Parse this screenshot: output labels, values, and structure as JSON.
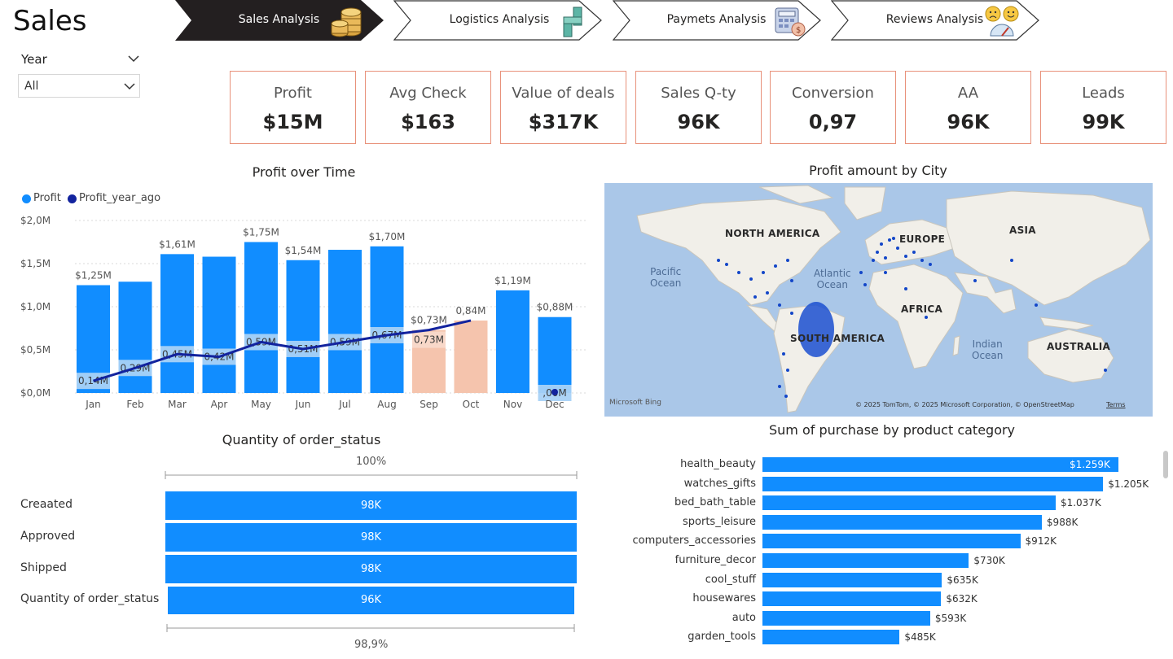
{
  "page_title": "Sales",
  "nav": {
    "tabs": [
      {
        "label": "Sales Analysis",
        "active": true,
        "icon": "coins-icon"
      },
      {
        "label": "Logistics Analysis",
        "active": false,
        "icon": "route-icon"
      },
      {
        "label": "Paymets Analysis",
        "active": false,
        "icon": "calculator-icon"
      },
      {
        "label": "Reviews Analysis",
        "active": false,
        "icon": "emoji-rating-icon"
      }
    ]
  },
  "slicer": {
    "label": "Year",
    "value": "All"
  },
  "kpis": [
    {
      "label": "Profit",
      "value": "$15M"
    },
    {
      "label": "Avg Check",
      "value": "$163"
    },
    {
      "label": "Value of deals",
      "value": "$317K"
    },
    {
      "label": "Sales Q-ty",
      "value": "96K"
    },
    {
      "label": "Conversion",
      "value": "0,97"
    },
    {
      "label": "AA",
      "value": "96K"
    },
    {
      "label": "Leads",
      "value": "99K"
    }
  ],
  "colors": {
    "accent": "#118dff",
    "dark_series": "#12239e",
    "forecast": "#f5c4ad",
    "kpi_border": "#e8917a",
    "active_tab": "#231f20"
  },
  "profit_chart": {
    "title": "Profit over Time",
    "legend": [
      "Profit",
      "Profit_year_ago"
    ],
    "y_ticks": [
      "$2,0M",
      "$1,5M",
      "$1,0M",
      "$0,5M",
      "$0,0M"
    ],
    "chart_data": {
      "type": "bar",
      "categories": [
        "Jan",
        "Feb",
        "Mar",
        "Apr",
        "May",
        "Jun",
        "Jul",
        "Aug",
        "Sep",
        "Oct",
        "Nov",
        "Dec"
      ],
      "series": [
        {
          "name": "Profit",
          "values": [
            1.25,
            1.29,
            1.61,
            1.58,
            1.75,
            1.54,
            1.66,
            1.7,
            0.73,
            0.84,
            1.19,
            0.88
          ]
        },
        {
          "name": "Profit_year_ago",
          "values": [
            0.14,
            0.29,
            0.45,
            0.42,
            0.59,
            0.51,
            0.59,
            0.67,
            0.73,
            0.84,
            null,
            0.0
          ]
        }
      ],
      "highlighted": [
        false,
        false,
        false,
        false,
        false,
        false,
        false,
        false,
        true,
        true,
        false,
        false
      ],
      "ylim": [
        0,
        2.0
      ],
      "top_labels": [
        "$1,25M",
        "",
        "$1,61M",
        "",
        "$1,75M",
        "$1,54M",
        "",
        "$1,70M",
        "$0,73M",
        "0,84M",
        "$1,19M",
        "$0,88M"
      ],
      "inner_labels": [
        "0,14M",
        "0,29M",
        "0,45M",
        "0,42M",
        "0,59M",
        "0,51M",
        "0,59M",
        "0,67M",
        "0,73M",
        "",
        "",
        ",00M"
      ]
    }
  },
  "map": {
    "title": "Profit amount by City",
    "continents": [
      "NORTH AMERICA",
      "EUROPE",
      "ASIA",
      "AFRICA",
      "SOUTH AMERICA",
      "AUSTRALIA"
    ],
    "oceans": [
      "Pacific\nOcean",
      "Atlantic\nOcean",
      "Indian\nOcean"
    ],
    "brand": "Microsoft Bing",
    "attribution": "© 2025 TomTom, © 2025 Microsoft Corporation, © OpenStreetMap",
    "terms": "Terms"
  },
  "order_status": {
    "title": "Quantity of order_status",
    "top_pct": "100%",
    "bottom_pct": "98,9%",
    "rows": [
      {
        "label": "Creaated",
        "value": "98K",
        "n": 98
      },
      {
        "label": "Approved",
        "value": "98K",
        "n": 98
      },
      {
        "label": "Shipped",
        "value": "98K",
        "n": 98
      },
      {
        "label": "Quantity of order_status",
        "value": "96K",
        "n": 96.9
      }
    ]
  },
  "category_chart": {
    "title": "Sum of purchase by product category",
    "chart_data": {
      "type": "bar",
      "categories": [
        "health_beauty",
        "watches_gifts",
        "bed_bath_table",
        "sports_leisure",
        "computers_accessories",
        "furniture_decor",
        "cool_stuff",
        "housewares",
        "auto",
        "garden_tools"
      ],
      "values": [
        1259,
        1205,
        1037,
        988,
        912,
        730,
        635,
        632,
        593,
        485
      ],
      "value_labels": [
        "$1.259K",
        "$1.205K",
        "$1.037K",
        "$988K",
        "$912K",
        "$730K",
        "$635K",
        "$632K",
        "$593K",
        "$485K"
      ]
    }
  }
}
